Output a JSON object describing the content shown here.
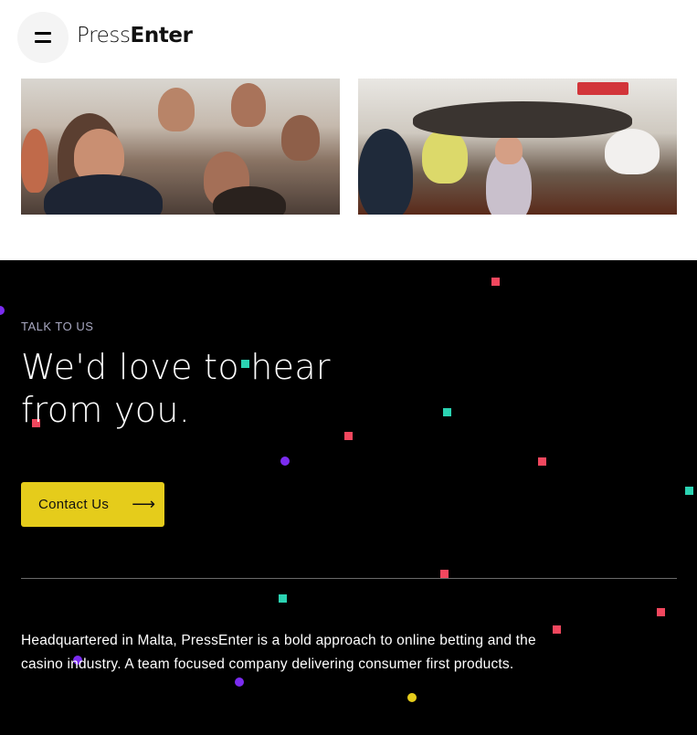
{
  "header": {
    "logo_light": "Press",
    "logo_bold": "Enter"
  },
  "contact": {
    "eyebrow": "TALK TO US",
    "headline": "We'd love to hear from you.",
    "cta_label": "Contact Us",
    "cta_arrow": "⟶"
  },
  "about": {
    "text": "Headquartered in Malta, PressEnter is a bold approach to online betting and the casino industry. A team focused company delivering consumer first products."
  },
  "colors": {
    "background_dark": "#000000",
    "accent_yellow": "#e5cc1b",
    "confetti_red": "#f2475e",
    "confetti_teal": "#2bd3b2",
    "confetti_purple": "#7b2cf0",
    "confetti_yellow": "#e5cc1b"
  },
  "icons": {
    "menu": "menu-icon",
    "arrow": "arrow-right-icon"
  }
}
